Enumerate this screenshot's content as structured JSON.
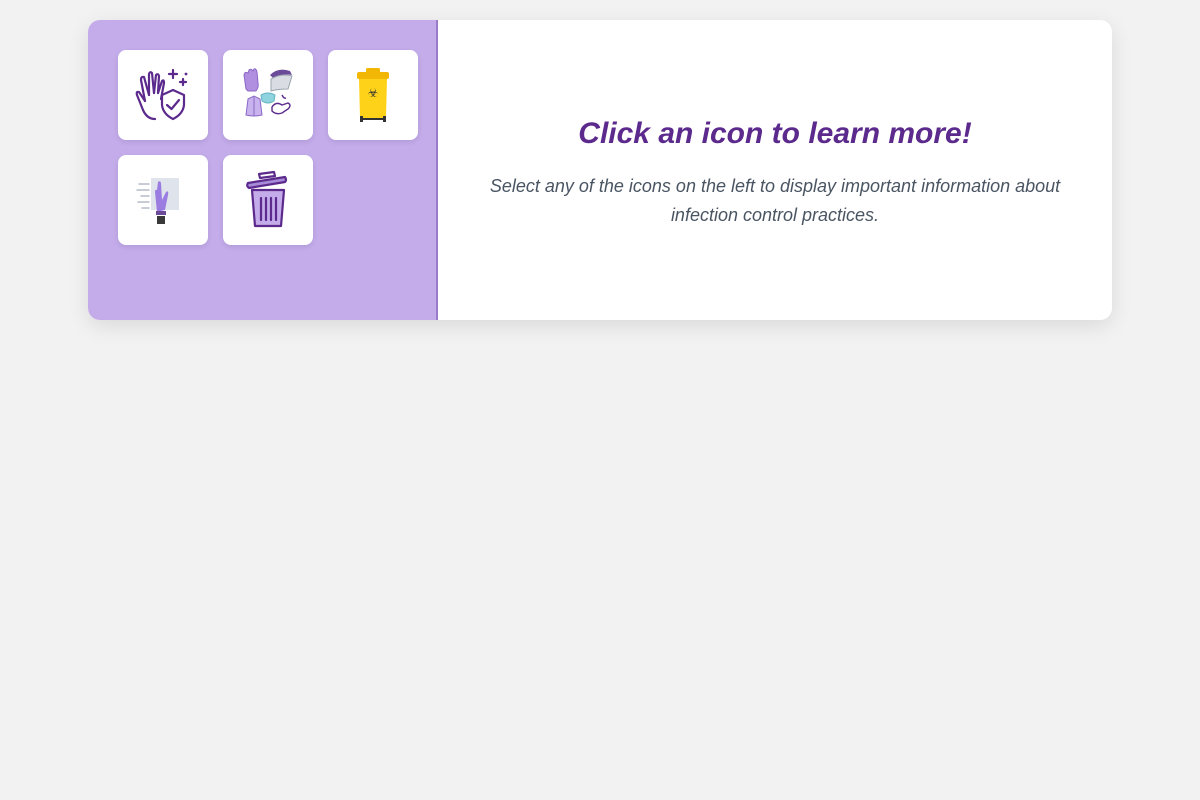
{
  "sidebar": {
    "icons": [
      {
        "name": "hand-hygiene-icon"
      },
      {
        "name": "ppe-icon"
      },
      {
        "name": "biohazard-bin-icon"
      },
      {
        "name": "glove-removal-icon"
      },
      {
        "name": "trash-bin-icon"
      }
    ],
    "colors": {
      "background": "#c3ace9",
      "border": "#9a7bc9",
      "icon_purple": "#5b2a8c",
      "bin_yellow": "#ffd21a"
    }
  },
  "main": {
    "heading": "Click an icon to learn more!",
    "description": "Select any of the icons on the left to display important information about infection control practices.",
    "colors": {
      "heading": "#5b2a8c",
      "description": "#4a5563"
    }
  }
}
